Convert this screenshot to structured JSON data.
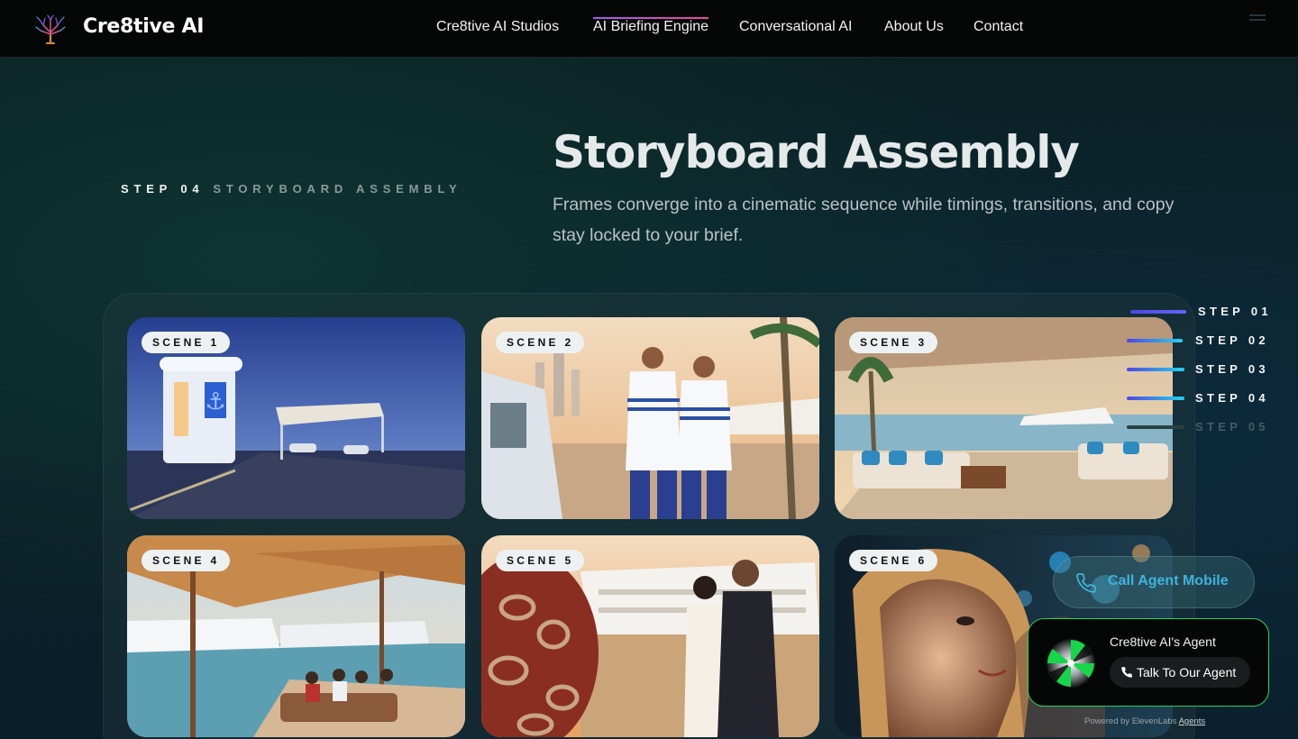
{
  "header": {
    "brand": "Cre8tive AI",
    "logo_icon": "tree-logo-icon",
    "nav": [
      {
        "label": "Cre8tive AI Studios",
        "active": false
      },
      {
        "label": "AI Briefing Engine",
        "active": true
      },
      {
        "label": "Conversational AI",
        "active": false
      },
      {
        "label": "About Us",
        "active": false
      },
      {
        "label": "Contact",
        "active": false
      }
    ],
    "menu_icon": "hamburger-menu-icon"
  },
  "section": {
    "step_number": "STEP 04",
    "step_name": "STORYBOARD ASSEMBLY",
    "title": "Storyboard Assembly",
    "description": "Frames converge into a cinematic sequence while timings, transitions, and copy stay locked to your brief."
  },
  "scenes": [
    {
      "badge": "SCENE 1"
    },
    {
      "badge": "SCENE 2"
    },
    {
      "badge": "SCENE 3"
    },
    {
      "badge": "SCENE 4"
    },
    {
      "badge": "SCENE 5"
    },
    {
      "badge": "SCENE 6"
    }
  ],
  "steps_rail": [
    {
      "label": "STEP 01",
      "complete": true
    },
    {
      "label": "STEP 02",
      "complete": true
    },
    {
      "label": "STEP 03",
      "complete": true
    },
    {
      "label": "STEP 04",
      "complete": true
    },
    {
      "label": "STEP 05",
      "complete": false
    }
  ],
  "call_widget": {
    "mobile_label": "Call Agent Mobile",
    "phone_icon": "phone-icon",
    "agent_name": "Cre8tive AI's Agent",
    "talk_label": "Talk To Our Agent",
    "powered_prefix": "Powered by ElevenLabs",
    "powered_link": "Agents"
  },
  "colors": {
    "accent_purple": "#a855f7",
    "accent_pink": "#ec4899",
    "rail_gradient_start": "#4f46e5",
    "rail_gradient_end": "#22d3ee",
    "agent_border": "#27d35a",
    "call_text": "#3fb4dc"
  }
}
